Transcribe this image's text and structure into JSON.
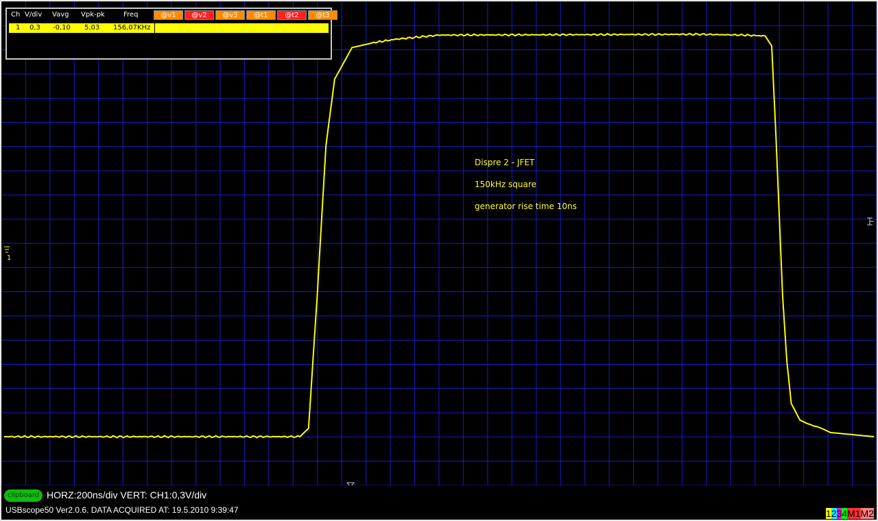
{
  "measurements": {
    "headers": {
      "ch": "Ch",
      "vdiv": "V/div",
      "vavg": "Vavg",
      "vpkpk": "Vpk-pk",
      "freq": "Freq"
    },
    "cursors": [
      {
        "label": "@v1",
        "color": "#ff8c00"
      },
      {
        "label": "@v2",
        "color": "#ff2020"
      },
      {
        "label": "@v3",
        "color": "#ff8c00"
      },
      {
        "label": "@t1",
        "color": "#ff8c00"
      },
      {
        "label": "@t2",
        "color": "#ff2020"
      },
      {
        "label": "@t3",
        "color": "#ff8c00"
      }
    ],
    "row": {
      "ch": "1",
      "vdiv": "0,3",
      "vavg": "-0,10",
      "vpkpk": "5,03",
      "freq": "156,07KHz"
    }
  },
  "annotations": {
    "line1": "Dispre 2 - JFET",
    "line2": "150kHz square",
    "line3": "generator rise time 10ns"
  },
  "status": {
    "clipboard_label": "clipboard",
    "scale": "HORZ:200ns/div VERT: CH1:0,3V/div",
    "info": "USBscope50 Ver2.0.6.  DATA ACQUIRED AT: 19.5.2010 9:39:47"
  },
  "legend": [
    {
      "label": "1",
      "color": "#ffff00"
    },
    {
      "label": "2",
      "color": "#00ffff"
    },
    {
      "label": "3",
      "color": "#ff00ff"
    },
    {
      "label": "4",
      "color": "#00ff00"
    },
    {
      "label": "M1",
      "color": "#ff3030"
    },
    {
      "label": "M2",
      "color": "#ff8080"
    }
  ],
  "colors": {
    "trace": "#ffff00",
    "grid": "#1a1ad0",
    "background": "#000000"
  },
  "markers": {
    "ground_marker": "1"
  },
  "chart_data": {
    "type": "line",
    "title": "",
    "xlabel": "",
    "ylabel": "",
    "x_units": "ns",
    "y_units": "V",
    "xlim": [
      0,
      2000
    ],
    "ylim": [
      -1.5,
      3.6
    ],
    "grid": true,
    "series": [
      {
        "name": "1",
        "x": [
          0,
          600,
          680,
          700,
          720,
          740,
          760,
          800,
          850,
          900,
          1000,
          1600,
          1700,
          1750,
          1765,
          1775,
          1790,
          1800,
          1810,
          1830,
          1850,
          1880,
          1900,
          2000
        ],
        "y": [
          0.0,
          0.0,
          0.0,
          0.1,
          1.7,
          3.5,
          4.3,
          4.68,
          4.74,
          4.78,
          4.83,
          4.84,
          4.83,
          4.82,
          4.7,
          3.6,
          1.7,
          0.9,
          0.4,
          0.2,
          0.15,
          0.1,
          0.05,
          0.0
        ]
      }
    ]
  }
}
